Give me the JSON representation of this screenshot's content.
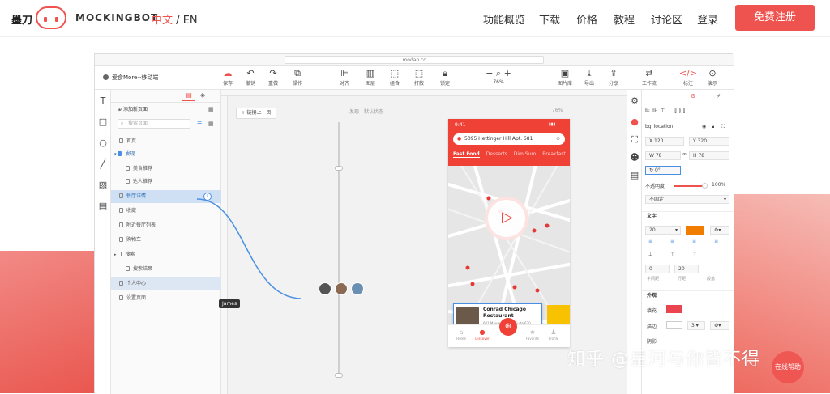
{
  "nav": {
    "brand_cn": "墨刀",
    "brand_en": "MOCKINGBOT",
    "lang_active": "中文",
    "lang_sep": "/",
    "lang_other": "EN",
    "menu": [
      "功能概览",
      "下载",
      "价格",
      "教程",
      "讨论区",
      "登录"
    ],
    "cta": "免费注册"
  },
  "app": {
    "url": "modao.cc",
    "doc_title": "爱食More--移动端",
    "toolbar": [
      {
        "label": "保存",
        "icon": "cloud-save-icon"
      },
      {
        "label": "撤销",
        "icon": "undo-icon"
      },
      {
        "label": "重做",
        "icon": "redo-icon"
      },
      {
        "label": "操作",
        "icon": "copy-icon"
      },
      {
        "label": "对齐",
        "icon": "align-icon"
      },
      {
        "label": "图层",
        "icon": "layers-icon"
      },
      {
        "label": "组合",
        "icon": "group-icon"
      },
      {
        "label": "打散",
        "icon": "ungroup-icon"
      },
      {
        "label": "锁定",
        "icon": "lock-icon"
      },
      {
        "label": "图片库",
        "icon": "image-icon"
      },
      {
        "label": "导出",
        "icon": "download-icon"
      },
      {
        "label": "分享",
        "icon": "share-icon"
      },
      {
        "label": "工作流",
        "icon": "workflow-icon"
      },
      {
        "label": "标注",
        "icon": "code-icon"
      },
      {
        "label": "演示",
        "icon": "play-icon"
      }
    ],
    "zoom": "76%",
    "pages_panel": {
      "add_page": "添加新页面",
      "search_placeholder": "搜索页面",
      "items": [
        {
          "label": "首页",
          "level": 0
        },
        {
          "label": "发现",
          "level": 0,
          "folder": true
        },
        {
          "label": "美食推荐",
          "level": 1
        },
        {
          "label": "达人推荐",
          "level": 1
        },
        {
          "label": "餐厅详情",
          "level": 0,
          "selected": true
        },
        {
          "label": "收藏",
          "level": 0
        },
        {
          "label": "附近餐厅列表",
          "level": 0
        },
        {
          "label": "购物车",
          "level": 0
        },
        {
          "label": "搜索",
          "level": 0,
          "folder": true
        },
        {
          "label": "搜索结果",
          "level": 1
        },
        {
          "label": "个人中心",
          "level": 0,
          "hover": true
        },
        {
          "label": "设置页面",
          "level": 0
        }
      ]
    },
    "canvas": {
      "link_button": "链接上一页",
      "frame_label": "发现 - 默认状态",
      "frame_pct": "76%",
      "tooltip": "James"
    },
    "phone": {
      "time": "9:41",
      "address": "5095 Hettinger Hill Apt. 681",
      "categories": [
        "Fast Food",
        "Desserts",
        "Dim Sum",
        "Breakfast"
      ],
      "card_name": "Conrad Chicago Restaurant",
      "card_address": "601 Maureen Drive Suite 670",
      "card_stars": "★★★★★",
      "tabs": [
        "Home",
        "Discover",
        "",
        "Favorite",
        "Profile"
      ]
    },
    "props": {
      "layer_name": "bg_location",
      "x_label": "X",
      "x": "120",
      "y_label": "Y",
      "y": "320",
      "w_label": "W",
      "w": "78",
      "h_label": "H",
      "h": "78",
      "rotation": "0°",
      "opacity_label": "不透明度",
      "opacity": "100%",
      "fixed": "不固定",
      "text_section": "文字",
      "font_size": "20",
      "letter_spacing": "0",
      "line_height": "20",
      "spacing_labels": [
        "字间距",
        "行距",
        "段落"
      ],
      "appearance_section": "外观",
      "fill_label": "填充",
      "fill_color": "#e8454f",
      "border_label": "描边",
      "border_width": "3",
      "text_color": "#f07c00",
      "shadow_label": "阴影"
    }
  },
  "watermark": "知乎 @星河与你皆不得",
  "help_button": "在线帮助",
  "colors": {
    "brand": "#ef5350",
    "selection": "#4a90e2"
  }
}
